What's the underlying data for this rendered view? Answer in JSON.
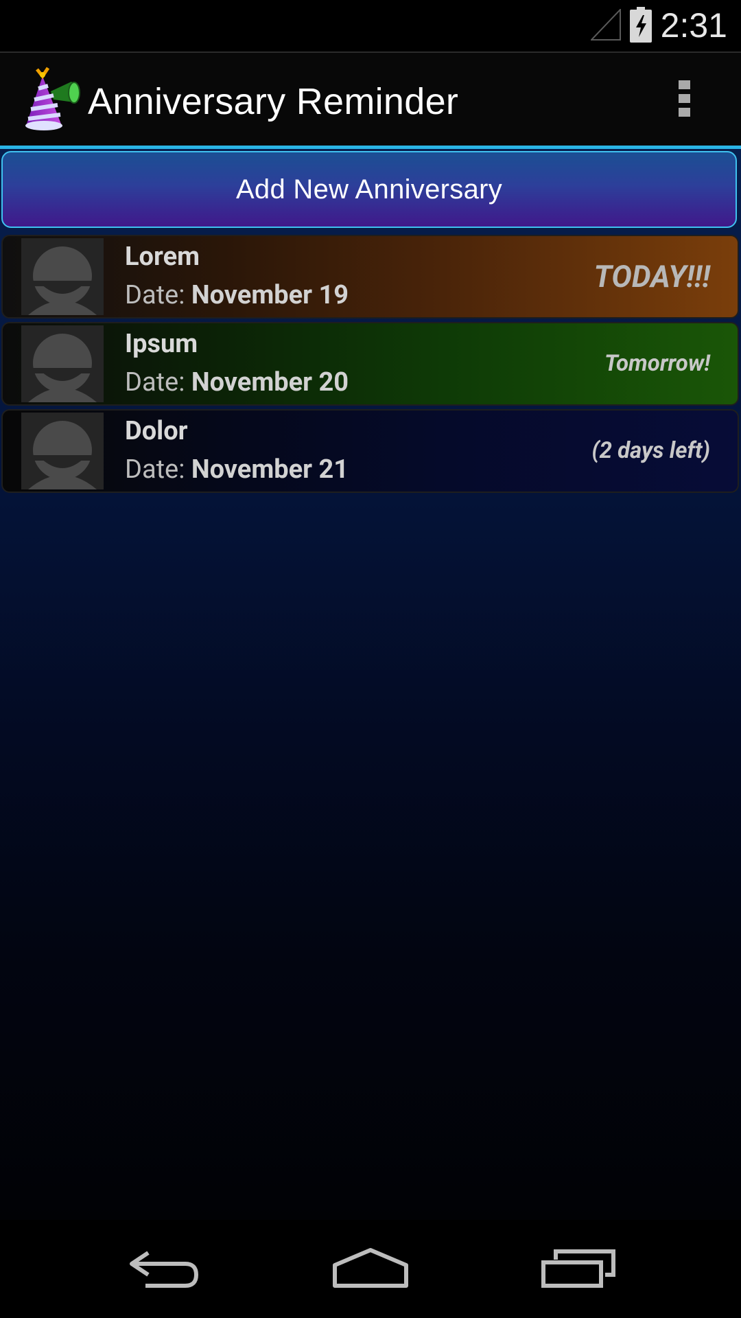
{
  "status_bar": {
    "time": "2:31",
    "icons": [
      "signal-icon",
      "battery-charging-icon"
    ]
  },
  "action_bar": {
    "app_title": "Anniversary Reminder",
    "app_icon": "party-hat-icon",
    "overflow_icon": "overflow-menu-icon"
  },
  "add_button": {
    "label": "Add New Anniversary"
  },
  "anniversaries": [
    {
      "name": "Lorem",
      "date_label": "Date: ",
      "date": "November 19",
      "status": "TODAY!!!",
      "accent": "#7a3e0b"
    },
    {
      "name": "Ipsum",
      "date_label": "Date: ",
      "date": "November 20",
      "status": "Tomorrow!",
      "accent": "#1a5607"
    },
    {
      "name": "Dolor",
      "date_label": "Date: ",
      "date": "November 21",
      "status": "(2 days left)",
      "accent": "#070c37"
    }
  ],
  "colors": {
    "divider": "#2ab4e6",
    "button_border": "#3fc2f0"
  },
  "nav_bar": {
    "icons": [
      "back-icon",
      "home-icon",
      "recent-apps-icon"
    ]
  }
}
